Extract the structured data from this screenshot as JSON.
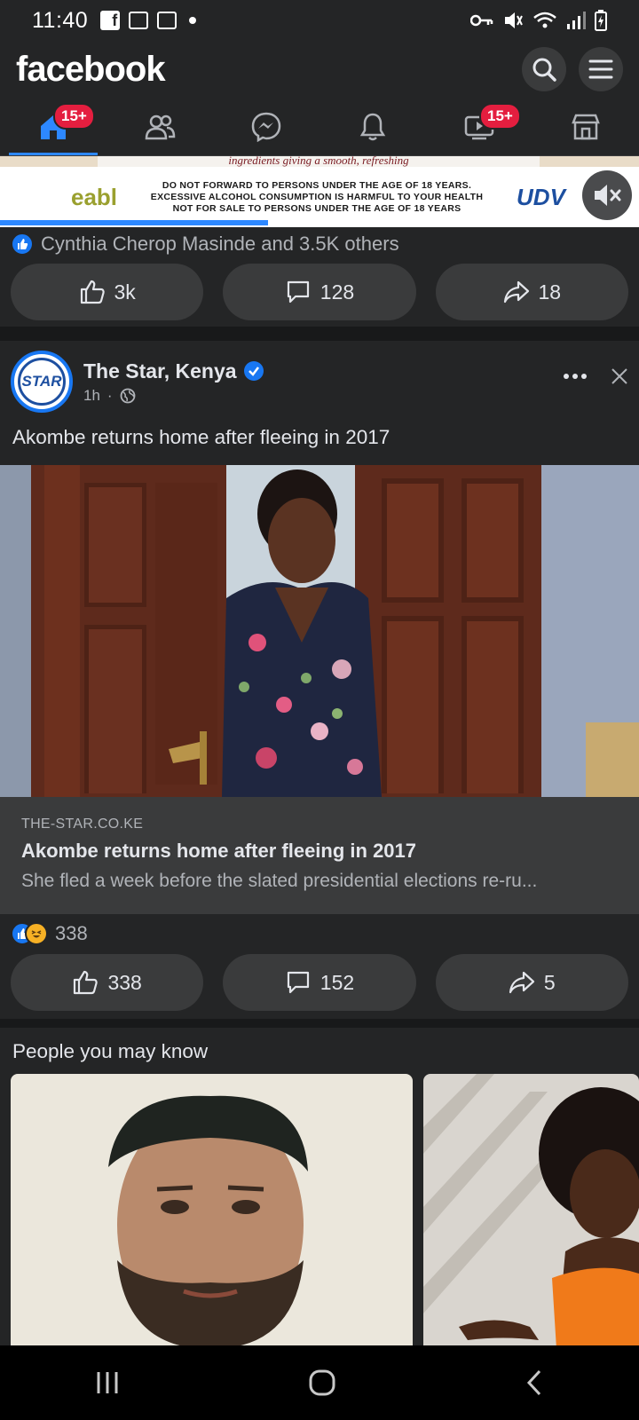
{
  "status_bar": {
    "time": "11:40"
  },
  "header": {
    "logo": "facebook"
  },
  "nav": {
    "tabs": [
      {
        "name": "home",
        "badge": "15+"
      },
      {
        "name": "friends",
        "badge": ""
      },
      {
        "name": "messenger",
        "badge": ""
      },
      {
        "name": "notifications",
        "badge": ""
      },
      {
        "name": "watch",
        "badge": "15+"
      },
      {
        "name": "marketplace",
        "badge": ""
      }
    ]
  },
  "ad": {
    "top_text": "ingredients giving a smooth, refreshing",
    "left_brand": "eabl",
    "warning_line1": "DO NOT FORWARD TO PERSONS UNDER THE AGE OF 18 YEARS.",
    "warning_line2": "EXCESSIVE ALCOHOL CONSUMPTION IS HARMFUL TO YOUR HEALTH",
    "warning_line3": "NOT FOR SALE TO PERSONS UNDER THE AGE OF 18 YEARS",
    "right_brand": "UDV",
    "progress_percent": 42
  },
  "post1": {
    "reactions_text": "Cynthia Cherop Masinde and 3.5K others",
    "like_count": "3k",
    "comment_count": "128",
    "share_count": "18"
  },
  "post2": {
    "author": "The Star, Kenya",
    "avatar_text": "STAR",
    "time": "1h",
    "text": "Akombe returns home after fleeing in 2017",
    "link_domain": "THE-STAR.CO.KE",
    "link_title": "Akombe returns home after fleeing in 2017",
    "link_desc": "She fled a week before the slated presidential elections re-ru...",
    "reaction_count": "338",
    "like_count": "338",
    "comment_count": "152",
    "share_count": "5"
  },
  "pymk": {
    "title": "People you may know"
  },
  "colors": {
    "accent": "#1877f2",
    "badge": "#e41e3f",
    "bg": "#18191a",
    "card": "#242526"
  }
}
